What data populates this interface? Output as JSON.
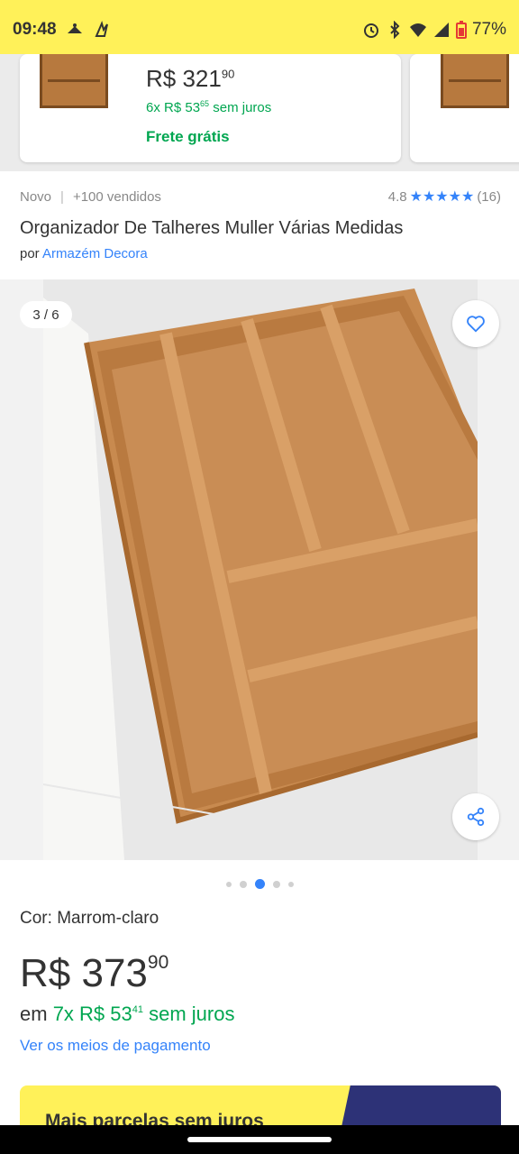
{
  "status_bar": {
    "time": "09:48",
    "battery": "77%",
    "icons": [
      "notification-icon",
      "app-icon",
      "alarm-icon",
      "bluetooth-icon",
      "wifi-icon",
      "signal-icon",
      "battery-icon"
    ]
  },
  "related_card": {
    "price_main": "R$ 321",
    "price_cents": "90",
    "installments_prefix": "6x R$ 53",
    "installments_cents": "65",
    "installments_suffix": "sem juros",
    "shipping": "Frete grátis"
  },
  "product": {
    "condition": "Novo",
    "sold": "+100 vendidos",
    "rating": "4.8",
    "stars": "★★★★★",
    "reviews": "(16)",
    "title": "Organizador De Talheres Muller Várias Medidas",
    "seller_prefix": "por",
    "seller_name": "Armazém Decora"
  },
  "gallery": {
    "counter": "3 / 6",
    "current_index": 3,
    "total": 6
  },
  "details": {
    "color_label": "Cor:",
    "color_value": "Marrom-claro",
    "price_main": "R$ 373",
    "price_cents": "90",
    "installments_prefix": "em",
    "installments_main": "7x R$ 53",
    "installments_cents": "41",
    "installments_suffix": "sem juros",
    "payment_link": "Ver os meios de pagamento"
  },
  "banner": {
    "text": "Mais parcelas sem juros"
  },
  "colors": {
    "brand_yellow": "#fff159",
    "link_blue": "#3483fa",
    "green": "#00a650"
  }
}
